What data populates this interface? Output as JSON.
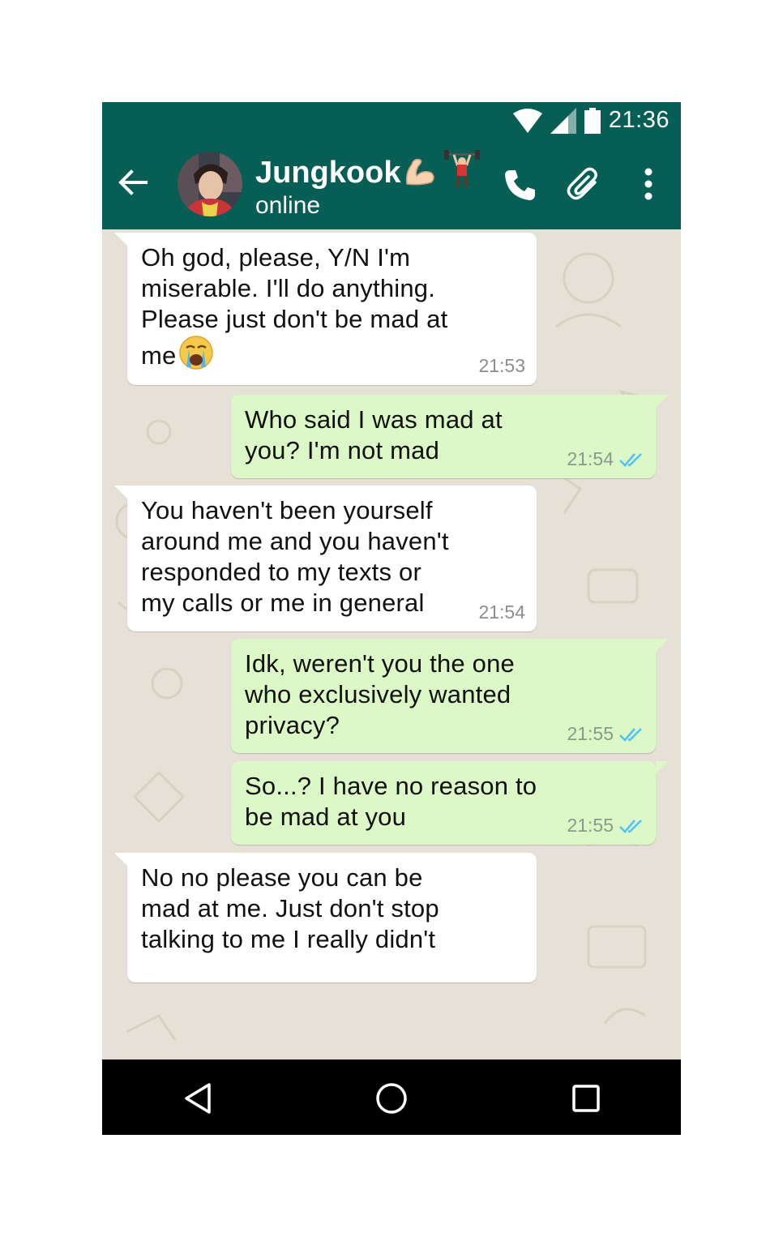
{
  "status_bar": {
    "time": "21:36"
  },
  "header": {
    "contact_name": "Jungkook",
    "contact_status": "online"
  },
  "messages": [
    {
      "direction": "incoming",
      "text": "Oh god, please, Y/N I'm\nmiserable. I'll do anything.\nPlease just don't be mad at\nme",
      "time": "21:53",
      "emoji": "loudly-crying-face"
    },
    {
      "direction": "outgoing",
      "text": "Who said I was mad at\nyou? I'm not mad",
      "time": "21:54",
      "status": "read"
    },
    {
      "direction": "incoming",
      "text": "You haven't been yourself\naround me and you haven't\nresponded to my texts or\nmy calls or me in general",
      "time": "21:54"
    },
    {
      "direction": "outgoing",
      "text": "Idk, weren't you the one\nwho exclusively wanted\nprivacy?",
      "time": "21:55",
      "status": "read"
    },
    {
      "direction": "outgoing",
      "text": "So...? I have no reason to\nbe mad at you",
      "time": "21:55",
      "status": "read"
    },
    {
      "direction": "incoming",
      "text": "No no please you can be\nmad at me. Just don't stop\ntalking to me I really didn't",
      "time": ""
    }
  ],
  "colors": {
    "header": "#075e54",
    "accent": "#128c7e",
    "outgoing_bubble": "#dcf8c6",
    "read_tick": "#4fc3f7"
  },
  "icons": [
    "wifi-icon",
    "signal-icon",
    "battery-icon",
    "back-arrow-icon",
    "phone-icon",
    "attach-icon",
    "more-icon",
    "emoji-icon",
    "camera-icon",
    "mic-icon",
    "nav-back-icon",
    "nav-home-icon",
    "nav-recents-icon"
  ]
}
